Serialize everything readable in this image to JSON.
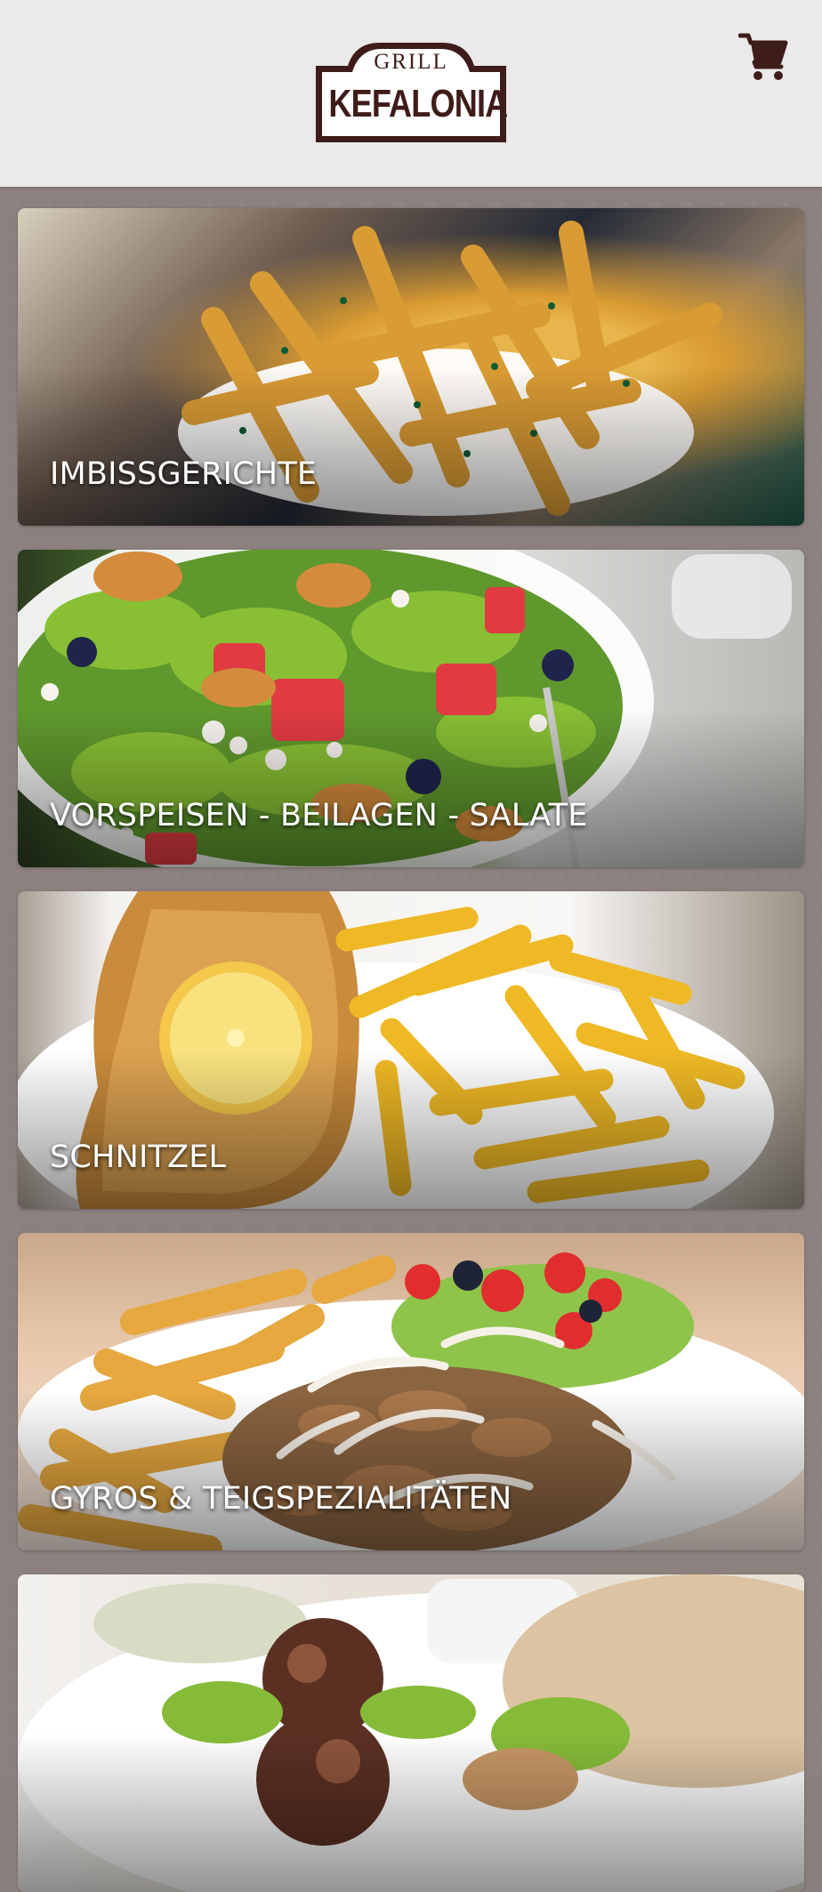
{
  "header": {
    "logo": {
      "top_text": "GRILL",
      "main_text": "KEFALONIA"
    },
    "cart_icon": "cart-icon"
  },
  "menu": {
    "categories": [
      {
        "label": "IMBISSGERICHTE"
      },
      {
        "label": "VORSPEISEN - BEILAGEN - SALATE"
      },
      {
        "label": "SCHNITZEL"
      },
      {
        "label": "GYROS & TEIGSPEZIALITÄTEN"
      },
      {
        "label": ""
      }
    ]
  },
  "colors": {
    "header_background": "#ebe9e9",
    "brand": "#3e1c1a",
    "page_background": "#8c817f",
    "card_text": "#ffffff"
  }
}
